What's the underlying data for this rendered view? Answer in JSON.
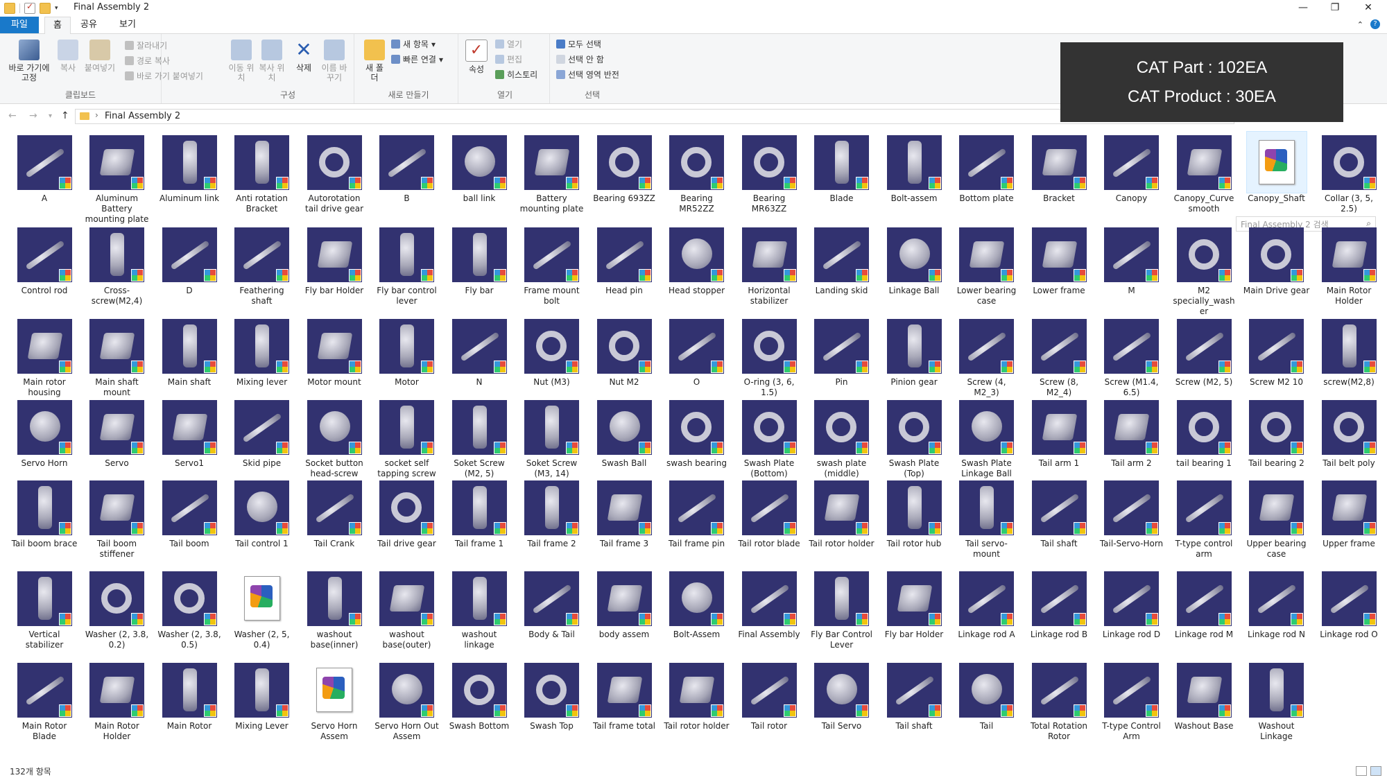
{
  "window": {
    "title": "Final Assembly 2",
    "min": "—",
    "max": "❐",
    "close": "✕"
  },
  "ribbon_tabs": [
    "파일",
    "홈",
    "공유",
    "보기"
  ],
  "ribbon": {
    "clipboard": {
      "pin_label": "바로 가기에 고정",
      "copy": "복사",
      "paste": "붙여넣기",
      "cut": "잘라내기",
      "copy_path": "경로 복사",
      "paste_shortcut": "바로 가기 붙여넣기",
      "group": "클립보드"
    },
    "organize": {
      "move_to": "이동 위치",
      "copy_to": "복사 위치",
      "delete": "삭제",
      "rename": "이름 바꾸기",
      "group": "구성"
    },
    "new": {
      "new_folder": "새 폴더",
      "new_item": "새 항목",
      "easy_access": "빠른 연결",
      "group": "새로 만들기"
    },
    "open": {
      "properties": "속성",
      "open": "열기",
      "edit": "편집",
      "history": "히스토리",
      "group": "열기"
    },
    "select": {
      "select_all": "모두 선택",
      "select_none": "선택 안 함",
      "invert": "선택 영역 반전",
      "group": "선택"
    }
  },
  "overlay": {
    "line1": "CAT Part : 102EA",
    "line2": "CAT Product : 30EA"
  },
  "address": {
    "path": "Final Assembly 2",
    "search_placeholder": "Final Assembly 2 검색"
  },
  "items": [
    {
      "label": "A",
      "kind": "rod"
    },
    {
      "label": "Aluminum Battery mounting plate",
      "kind": "box"
    },
    {
      "label": "Aluminum link",
      "kind": "tall"
    },
    {
      "label": "Anti rotation Bracket",
      "kind": "tall"
    },
    {
      "label": "Autorotation tail drive gear",
      "kind": "ring"
    },
    {
      "label": "B",
      "kind": "rod"
    },
    {
      "label": "ball link",
      "kind": "ball"
    },
    {
      "label": "Battery mounting plate",
      "kind": "box"
    },
    {
      "label": "Bearing 693ZZ",
      "kind": "ring"
    },
    {
      "label": "Bearing MR52ZZ",
      "kind": "ring"
    },
    {
      "label": "Bearing MR63ZZ",
      "kind": "ring"
    },
    {
      "label": "Blade",
      "kind": "tall"
    },
    {
      "label": "Bolt-assem",
      "kind": "tall"
    },
    {
      "label": "Bottom plate",
      "kind": "rod"
    },
    {
      "label": "Bracket",
      "kind": "box"
    },
    {
      "label": "Canopy",
      "kind": "rod"
    },
    {
      "label": "Canopy_Curve smooth",
      "kind": "box"
    },
    {
      "label": "Canopy_Shaft",
      "kind": "doc",
      "selected": true
    },
    {
      "label": "Collar (3, 5, 2.5)",
      "kind": "ring"
    },
    {
      "label": "Control rod",
      "kind": "rod"
    },
    {
      "label": "Cross-screw(M2,4)",
      "kind": "tall"
    },
    {
      "label": "D",
      "kind": "rod"
    },
    {
      "label": "Feathering shaft",
      "kind": "rod"
    },
    {
      "label": "Fly bar  Holder",
      "kind": "box"
    },
    {
      "label": "Fly bar control lever",
      "kind": "tall"
    },
    {
      "label": "Fly bar",
      "kind": "tall"
    },
    {
      "label": "Frame mount bolt",
      "kind": "rod"
    },
    {
      "label": "Head pin",
      "kind": "rod"
    },
    {
      "label": "Head stopper",
      "kind": "ball"
    },
    {
      "label": "Horizontal stabilizer",
      "kind": "box"
    },
    {
      "label": "Landing skid",
      "kind": "rod"
    },
    {
      "label": "Linkage Ball",
      "kind": "ball"
    },
    {
      "label": "Lower bearing case",
      "kind": "box"
    },
    {
      "label": "Lower frame",
      "kind": "box"
    },
    {
      "label": "M",
      "kind": "rod"
    },
    {
      "label": "M2 specially_washer",
      "kind": "ring"
    },
    {
      "label": "Main Drive gear",
      "kind": "ring"
    },
    {
      "label": "Main Rotor Holder",
      "kind": "box"
    },
    {
      "label": "Main rotor housing",
      "kind": "box"
    },
    {
      "label": "Main shaft mount",
      "kind": "box"
    },
    {
      "label": "Main shaft",
      "kind": "tall"
    },
    {
      "label": "Mixing lever",
      "kind": "tall"
    },
    {
      "label": "Motor mount",
      "kind": "box"
    },
    {
      "label": "Motor",
      "kind": "tall"
    },
    {
      "label": "N",
      "kind": "rod"
    },
    {
      "label": "Nut (M3)",
      "kind": "ring"
    },
    {
      "label": "Nut M2",
      "kind": "ring"
    },
    {
      "label": "O",
      "kind": "rod"
    },
    {
      "label": "O-ring (3, 6, 1.5)",
      "kind": "ring"
    },
    {
      "label": "Pin",
      "kind": "rod"
    },
    {
      "label": "Pinion gear",
      "kind": "tall"
    },
    {
      "label": "Screw (4, M2_3)",
      "kind": "rod"
    },
    {
      "label": "Screw (8, M2_4)",
      "kind": "rod"
    },
    {
      "label": "Screw (M1.4, 6.5)",
      "kind": "rod"
    },
    {
      "label": "Screw (M2, 5)",
      "kind": "rod"
    },
    {
      "label": "Screw M2 10",
      "kind": "rod"
    },
    {
      "label": "screw(M2,8)",
      "kind": "tall"
    },
    {
      "label": "Servo Horn",
      "kind": "ball"
    },
    {
      "label": "Servo",
      "kind": "box"
    },
    {
      "label": "Servo1",
      "kind": "box"
    },
    {
      "label": "Skid pipe",
      "kind": "rod"
    },
    {
      "label": "Socket button head-screw",
      "kind": "ball"
    },
    {
      "label": "socket self tapping screw",
      "kind": "tall"
    },
    {
      "label": "Soket Screw (M2, 5)",
      "kind": "tall"
    },
    {
      "label": "Soket Screw (M3, 14)",
      "kind": "tall"
    },
    {
      "label": "Swash Ball",
      "kind": "ball"
    },
    {
      "label": "swash bearing",
      "kind": "ring"
    },
    {
      "label": "Swash Plate (Bottom)",
      "kind": "ring"
    },
    {
      "label": "swash plate (middle)",
      "kind": "ring"
    },
    {
      "label": "Swash Plate (Top)",
      "kind": "ring"
    },
    {
      "label": "Swash Plate Linkage Ball",
      "kind": "ball"
    },
    {
      "label": "Tail arm 1",
      "kind": "box"
    },
    {
      "label": "Tail arm 2",
      "kind": "box"
    },
    {
      "label": "tail bearing 1",
      "kind": "ring"
    },
    {
      "label": "Tail bearing 2",
      "kind": "ring"
    },
    {
      "label": "Tail belt poly",
      "kind": "ring"
    },
    {
      "label": "Tail boom brace",
      "kind": "tall"
    },
    {
      "label": "Tail boom stiffener",
      "kind": "box"
    },
    {
      "label": "Tail boom",
      "kind": "rod"
    },
    {
      "label": "Tail control 1",
      "kind": "ball"
    },
    {
      "label": "Tail Crank",
      "kind": "rod"
    },
    {
      "label": "Tail drive gear",
      "kind": "ring"
    },
    {
      "label": "Tail frame 1",
      "kind": "tall"
    },
    {
      "label": "Tail frame 2",
      "kind": "tall"
    },
    {
      "label": "Tail frame 3",
      "kind": "box"
    },
    {
      "label": "Tail frame pin",
      "kind": "rod"
    },
    {
      "label": "Tail rotor blade",
      "kind": "rod"
    },
    {
      "label": "Tail rotor holder",
      "kind": "box"
    },
    {
      "label": "Tail rotor hub",
      "kind": "tall"
    },
    {
      "label": "Tail servo-mount",
      "kind": "tall"
    },
    {
      "label": "Tail shaft",
      "kind": "rod"
    },
    {
      "label": "Tail-Servo-Horn",
      "kind": "rod"
    },
    {
      "label": "T-type control arm",
      "kind": "rod"
    },
    {
      "label": "Upper bearing case",
      "kind": "box"
    },
    {
      "label": "Upper frame",
      "kind": "box"
    },
    {
      "label": "Vertical stabilizer",
      "kind": "tall"
    },
    {
      "label": "Washer (2, 3.8, 0.2)",
      "kind": "ring"
    },
    {
      "label": "Washer (2, 3.8, 0.5)",
      "kind": "ring"
    },
    {
      "label": "Washer (2, 5, 0.4)",
      "kind": "doc"
    },
    {
      "label": "washout base(inner)",
      "kind": "tall"
    },
    {
      "label": "washout base(outer)",
      "kind": "box"
    },
    {
      "label": "washout linkage",
      "kind": "tall"
    },
    {
      "label": "Body & Tail",
      "kind": "rod"
    },
    {
      "label": "body assem",
      "kind": "box"
    },
    {
      "label": "Bolt-Assem",
      "kind": "ball"
    },
    {
      "label": "Final Assembly",
      "kind": "rod"
    },
    {
      "label": "Fly Bar Control Lever",
      "kind": "tall"
    },
    {
      "label": "Fly bar Holder",
      "kind": "box"
    },
    {
      "label": "Linkage rod A",
      "kind": "rod"
    },
    {
      "label": "Linkage rod B",
      "kind": "rod"
    },
    {
      "label": "Linkage rod D",
      "kind": "rod"
    },
    {
      "label": "Linkage rod M",
      "kind": "rod"
    },
    {
      "label": "Linkage rod N",
      "kind": "rod"
    },
    {
      "label": "Linkage rod O",
      "kind": "rod"
    },
    {
      "label": "Main Rotor Blade",
      "kind": "rod"
    },
    {
      "label": "Main Rotor Holder",
      "kind": "box"
    },
    {
      "label": "Main Rotor",
      "kind": "tall"
    },
    {
      "label": "Mixing Lever",
      "kind": "tall"
    },
    {
      "label": "Servo Horn Assem",
      "kind": "doc"
    },
    {
      "label": "Servo Horn Out Assem",
      "kind": "ball"
    },
    {
      "label": "Swash Bottom",
      "kind": "ring"
    },
    {
      "label": "Swash Top",
      "kind": "ring"
    },
    {
      "label": "Tail frame total",
      "kind": "box"
    },
    {
      "label": "Tail rotor holder",
      "kind": "box"
    },
    {
      "label": "Tail rotor",
      "kind": "rod"
    },
    {
      "label": "Tail Servo",
      "kind": "ball"
    },
    {
      "label": "Tail shaft",
      "kind": "rod"
    },
    {
      "label": "Tail",
      "kind": "ball"
    },
    {
      "label": "Total Rotation Rotor",
      "kind": "rod"
    },
    {
      "label": "T-type Control Arm",
      "kind": "rod"
    },
    {
      "label": "Washout Base",
      "kind": "box"
    },
    {
      "label": "Washout Linkage",
      "kind": "tall"
    }
  ],
  "status": {
    "count": "132개 항목"
  }
}
